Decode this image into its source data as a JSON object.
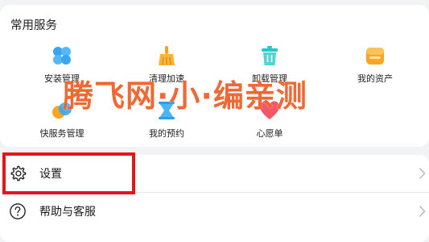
{
  "services": {
    "title": "常用服务",
    "items": [
      {
        "label": "安装管理",
        "icon": "install-manage-icon",
        "color": "#3aa6f2"
      },
      {
        "label": "清理加速",
        "icon": "broom-icon",
        "color": "#f4a21c"
      },
      {
        "label": "卸载管理",
        "icon": "trash-icon",
        "color": "#2cc6c6"
      },
      {
        "label": "我的资产",
        "icon": "wallet-icon",
        "color": "#f6a623"
      },
      {
        "label": "快服务管理",
        "icon": "quick-service-icon",
        "color": "#3aa6f2"
      },
      {
        "label": "我的预约",
        "icon": "reservation-icon",
        "color": "#4ab6f5"
      },
      {
        "label": "心愿单",
        "icon": "heart-icon",
        "color": "#f25767"
      }
    ]
  },
  "settings": {
    "settings_label": "设置",
    "help_label": "帮助与客服"
  },
  "watermark": "腾飞网·小·编亲测",
  "highlight_color": "#e8141b"
}
